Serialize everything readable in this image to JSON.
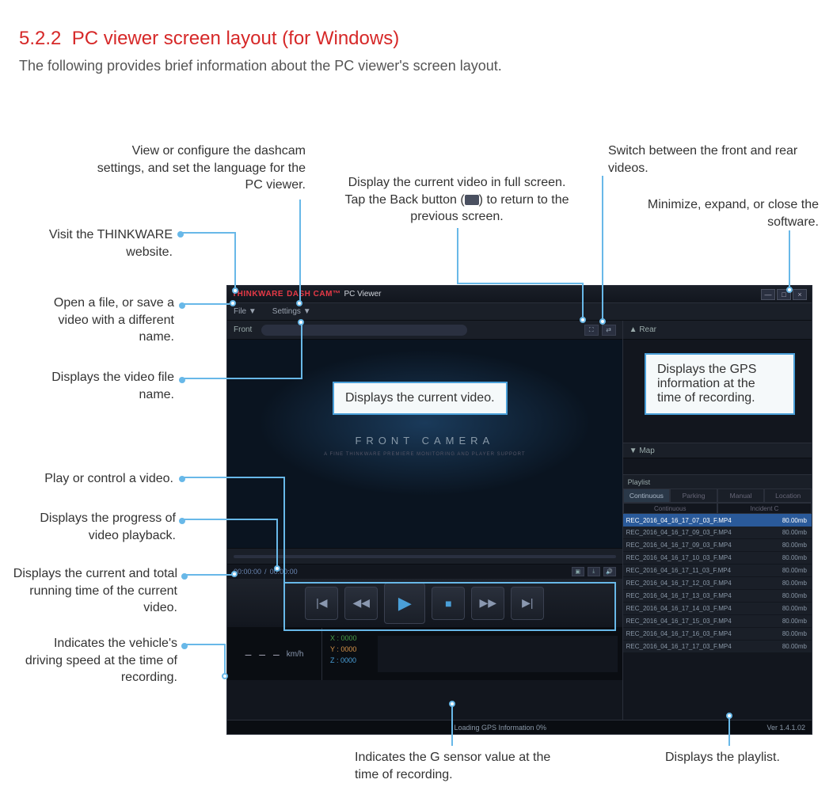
{
  "section": {
    "number": "5.2.2",
    "title": "PC viewer screen layout (for Windows)",
    "subtitle": "The following provides brief information about the PC viewer's screen layout."
  },
  "callouts": {
    "settings": "View or configure the dashcam settings, and set the language for the PC viewer.",
    "fullscreen": "Display the current video in full screen. Tap the Back button (",
    "fullscreen2": ") to return to the previous screen.",
    "switch": "Switch between the front and rear videos.",
    "winctrl": "Minimize, expand, or close the software.",
    "website": "Visit the THINKWARE website.",
    "file": "Open a file, or save a video with a different name.",
    "filename": "Displays the video file name.",
    "video": "Displays the current video.",
    "gps": "Displays the GPS information at the time of recording.",
    "play": "Play or control a video.",
    "progress": "Displays the progress of video playback.",
    "time": "Displays the current and total running time of the current video.",
    "speed": "Indicates the vehicle's driving speed at the time of recording.",
    "gsensor": "Indicates the G sensor value at the time of recording.",
    "playlist": "Displays the playlist."
  },
  "app": {
    "brand1": "THINKWARE",
    "brand2": "DASH CAM™",
    "brand3": "PC Viewer",
    "menu": {
      "file": "File ▼",
      "settings": "Settings ▼"
    },
    "front_label": "Front",
    "rear_label": "▲  Rear",
    "map_label": "▼  Map",
    "front_camera": "FRONT  CAMERA",
    "time": {
      "current": "00:00:00",
      "sep": "/",
      "total": "00:00:00"
    },
    "speed": {
      "dashes": "– – –",
      "unit": "km/h"
    },
    "gsensor": {
      "x": "X : 0000",
      "y": "Y : 0000",
      "z": "Z : 0000"
    },
    "playlist": {
      "title": "Playlist",
      "tabs": [
        "Continuous",
        "Parking",
        "Manual",
        "Location"
      ],
      "sub": {
        "col1": "Continuous",
        "col2": "Incident C"
      },
      "items": [
        {
          "name": "REC_2016_04_16_17_07_03_F.MP4",
          "size": "80.00mb"
        },
        {
          "name": "REC_2016_04_16_17_09_03_F.MP4",
          "size": "80.00mb"
        },
        {
          "name": "REC_2016_04_16_17_09_03_F.MP4",
          "size": "80.00mb"
        },
        {
          "name": "REC_2016_04_16_17_10_03_F.MP4",
          "size": "80.00mb"
        },
        {
          "name": "REC_2016_04_16_17_11_03_F.MP4",
          "size": "80.00mb"
        },
        {
          "name": "REC_2016_04_16_17_12_03_F.MP4",
          "size": "80.00mb"
        },
        {
          "name": "REC_2016_04_16_17_13_03_F.MP4",
          "size": "80.00mb"
        },
        {
          "name": "REC_2016_04_16_17_14_03_F.MP4",
          "size": "80.00mb"
        },
        {
          "name": "REC_2016_04_16_17_15_03_F.MP4",
          "size": "80.00mb"
        },
        {
          "name": "REC_2016_04_16_17_16_03_F.MP4",
          "size": "80.00mb"
        },
        {
          "name": "REC_2016_04_16_17_17_03_F.MP4",
          "size": "80.00mb"
        }
      ]
    },
    "status": {
      "loading": "Loading GPS Information  0%",
      "version": "Ver 1.4.1.02"
    }
  }
}
